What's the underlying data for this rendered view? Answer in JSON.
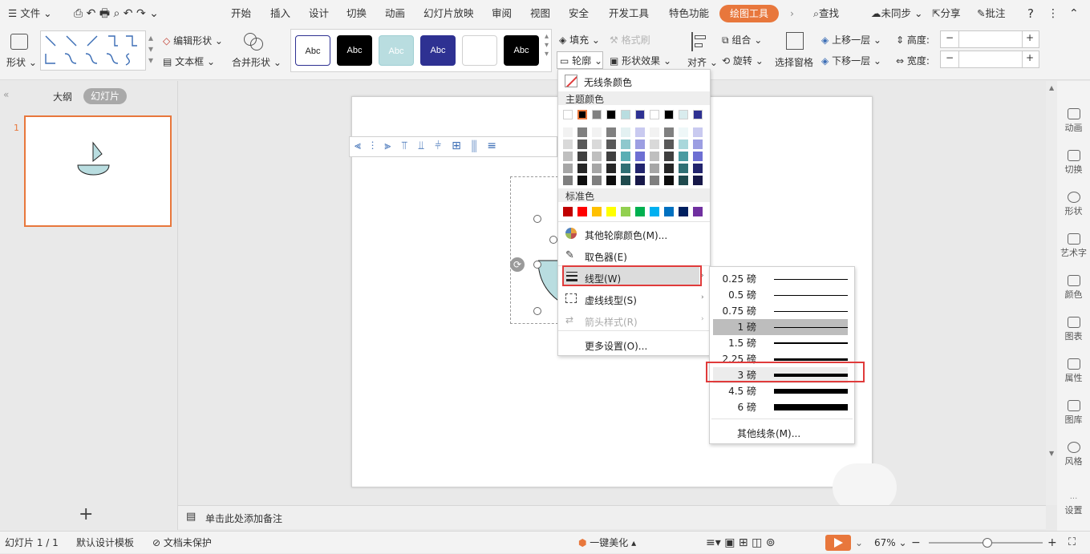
{
  "menubar": {
    "file": "文件",
    "tabs": [
      "开始",
      "插入",
      "设计",
      "切换",
      "动画",
      "幻灯片放映",
      "审阅",
      "视图",
      "安全",
      "开发工具",
      "特色功能"
    ],
    "active_tab": "绘图工具",
    "search": "查找",
    "sync": "未同步",
    "share": "分享",
    "comment": "批注"
  },
  "ribbon": {
    "shape": "形状",
    "edit_shape": "编辑形状",
    "text_box": "文本框",
    "merge_shapes": "合并形状",
    "style_label": "Abc",
    "fill": "填充",
    "format_painter": "格式刷",
    "outline": "轮廓",
    "shape_effects": "形状效果",
    "align": "对齐",
    "group": "组合",
    "rotate": "旋转",
    "selection_pane": "选择窗格",
    "bring_forward": "上移一层",
    "send_backward": "下移一层",
    "height": "高度:",
    "width": "宽度:",
    "minus": "−",
    "plus": "+"
  },
  "left_pane": {
    "outline_tab": "大纲",
    "slides_tab": "幻灯片",
    "slide_number": "1",
    "add": "+"
  },
  "notes_placeholder": "单击此处添加备注",
  "outline_menu": {
    "no_line": "无线条颜色",
    "theme_colors_title": "主题颜色",
    "theme_top": [
      "#ffffff",
      "#000000",
      "#808080",
      "#000000",
      "#b9dde0",
      "#2e3192",
      "#ffffff",
      "#000000",
      "#d9ecee",
      "#2e3192"
    ],
    "theme_shades": [
      [
        "#f2f2f2",
        "#808080",
        "#f2f2f2",
        "#808080",
        "#e3f1f2",
        "#c9caf0",
        "#f2f2f2",
        "#808080",
        "#eef7f8",
        "#c9caf0"
      ],
      [
        "#d9d9d9",
        "#595959",
        "#d9d9d9",
        "#595959",
        "#8ec8cd",
        "#9c9ee2",
        "#d9d9d9",
        "#595959",
        "#a9d7db",
        "#9c9ee2"
      ],
      [
        "#bfbfbf",
        "#404040",
        "#bfbfbf",
        "#404040",
        "#5aaeb4",
        "#6d6fd3",
        "#bfbfbf",
        "#404040",
        "#4a9ba1",
        "#6d6fd3"
      ],
      [
        "#a6a6a6",
        "#262626",
        "#a6a6a6",
        "#262626",
        "#2f6f74",
        "#22246e",
        "#a6a6a6",
        "#262626",
        "#2f6f74",
        "#22246e"
      ],
      [
        "#7f7f7f",
        "#0d0d0d",
        "#7f7f7f",
        "#0d0d0d",
        "#1f4a4d",
        "#171849",
        "#7f7f7f",
        "#0d0d0d",
        "#1f4a4d",
        "#171849"
      ]
    ],
    "standard_title": "标准色",
    "standard": [
      "#c00000",
      "#ff0000",
      "#ffc000",
      "#ffff00",
      "#92d050",
      "#00b050",
      "#00b0f0",
      "#0070c0",
      "#002060",
      "#7030a0"
    ],
    "more_colors": "其他轮廓颜色(M)...",
    "eyedropper": "取色器(E)",
    "line_type": "线型(W)",
    "dash_type": "虚线线型(S)",
    "arrow_style": "箭头样式(R)",
    "more_settings": "更多设置(O)..."
  },
  "line_weight_menu": {
    "items": [
      {
        "label": "0.25 磅",
        "w": 0.25
      },
      {
        "label": "0.5 磅",
        "w": 0.5
      },
      {
        "label": "0.75 磅",
        "w": 0.75
      },
      {
        "label": "1 磅",
        "w": 1
      },
      {
        "label": "1.5 磅",
        "w": 1.5
      },
      {
        "label": "2.25 磅",
        "w": 2.25
      },
      {
        "label": "3 磅",
        "w": 3
      },
      {
        "label": "4.5 磅",
        "w": 4.5
      },
      {
        "label": "6 磅",
        "w": 6
      }
    ],
    "selected": "1 磅",
    "hovered": "3 磅",
    "more_lines": "其他线条(M)..."
  },
  "right_sidebar": [
    "动画",
    "切换",
    "形状",
    "艺术字",
    "颜色",
    "图表",
    "属性",
    "图库",
    "风格",
    "设置"
  ],
  "status": {
    "slide_info": "幻灯片 1 / 1",
    "template": "默认设计模板",
    "protect": "文档未保护",
    "beautify": "一键美化",
    "zoom": "67%",
    "zoom_level": 0.67
  },
  "colors": {
    "accent": "#e8773c",
    "highlight_red": "#e03b3b",
    "shape_fill": "#b9dde0"
  }
}
